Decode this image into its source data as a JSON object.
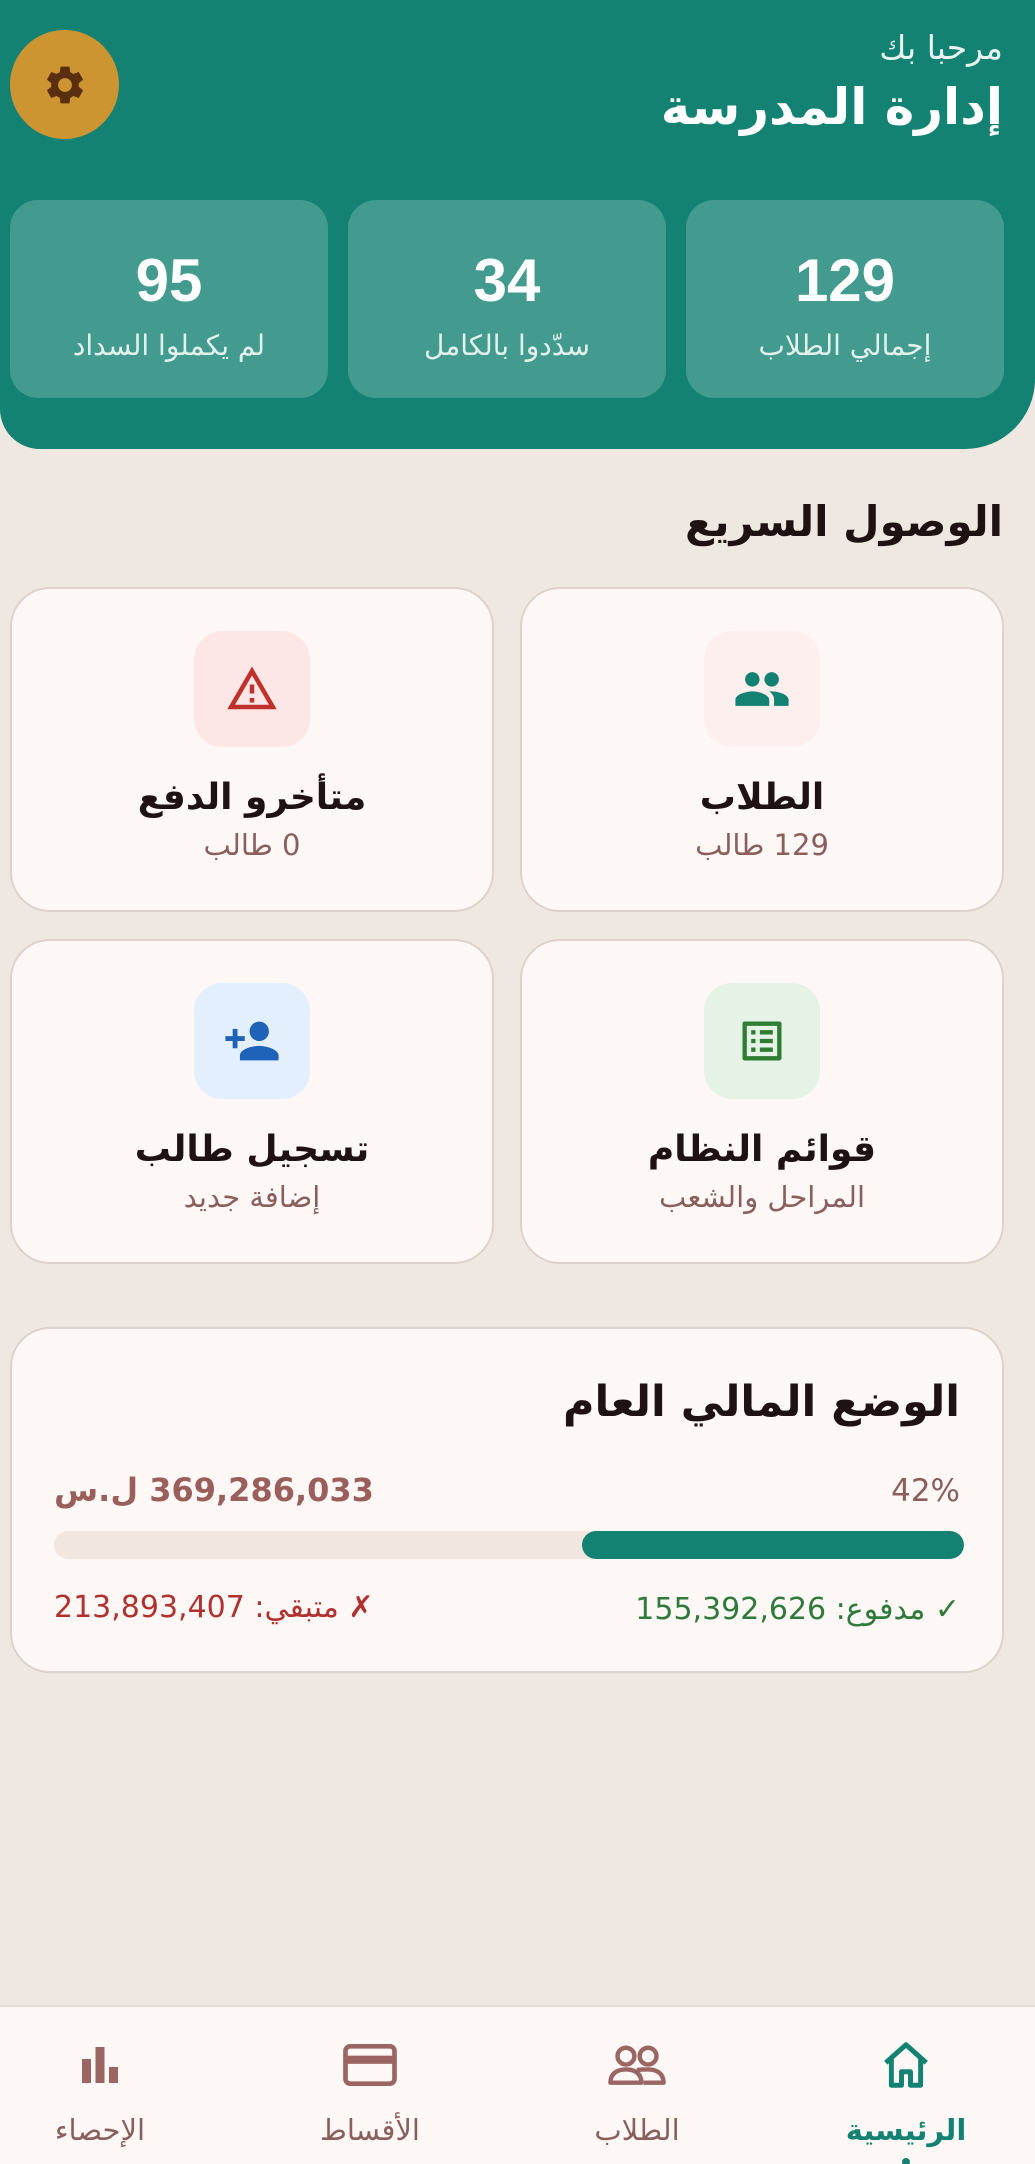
{
  "header": {
    "greeting": "مرحبا بك",
    "title": "إدارة المدرسة",
    "settings_icon": "gear-icon"
  },
  "stats": [
    {
      "value": "129",
      "label": "إجمالي الطلاب"
    },
    {
      "value": "34",
      "label": "سدّدوا بالكامل"
    },
    {
      "value": "95",
      "label": "لم يكملوا السداد"
    }
  ],
  "quick_access": {
    "title": "الوصول السريع",
    "cards": [
      {
        "title": "الطلاب",
        "subtitle": "129 طالب",
        "icon": "group-icon",
        "icon_color": "#138272",
        "bg": "#fcefed"
      },
      {
        "title": "متأخرو الدفع",
        "subtitle": "0 طالب",
        "icon": "warning-icon",
        "icon_color": "#c0312d",
        "bg": "#fde6e6"
      },
      {
        "title": "قوائم النظام",
        "subtitle": "المراحل والشعب",
        "icon": "list-icon",
        "icon_color": "#2e7d32",
        "bg": "#e5f3e6"
      },
      {
        "title": "تسجيل طالب",
        "subtitle": "إضافة جديد",
        "icon": "add-person-icon",
        "icon_color": "#1e63b8",
        "bg": "#e3effc"
      }
    ]
  },
  "finance": {
    "title": "الوضع المالي العام",
    "total": "369,286,033 ل.س",
    "percent": "42%",
    "progress": 0.42,
    "paid": "✓ مدفوع: 155,392,626",
    "remaining": "✗ متبقي: 213,893,407"
  },
  "nav": [
    {
      "label": "الرئيسية",
      "icon": "home-icon",
      "active": true
    },
    {
      "label": "الطلاب",
      "icon": "people-icon",
      "active": false
    },
    {
      "label": "الأقساط",
      "icon": "card-icon",
      "active": false
    },
    {
      "label": "الإحصاء",
      "icon": "bar-chart-icon",
      "active": false
    }
  ],
  "colors": {
    "primary": "#138272",
    "accent": "#cc9532",
    "background": "#efe7e2"
  }
}
